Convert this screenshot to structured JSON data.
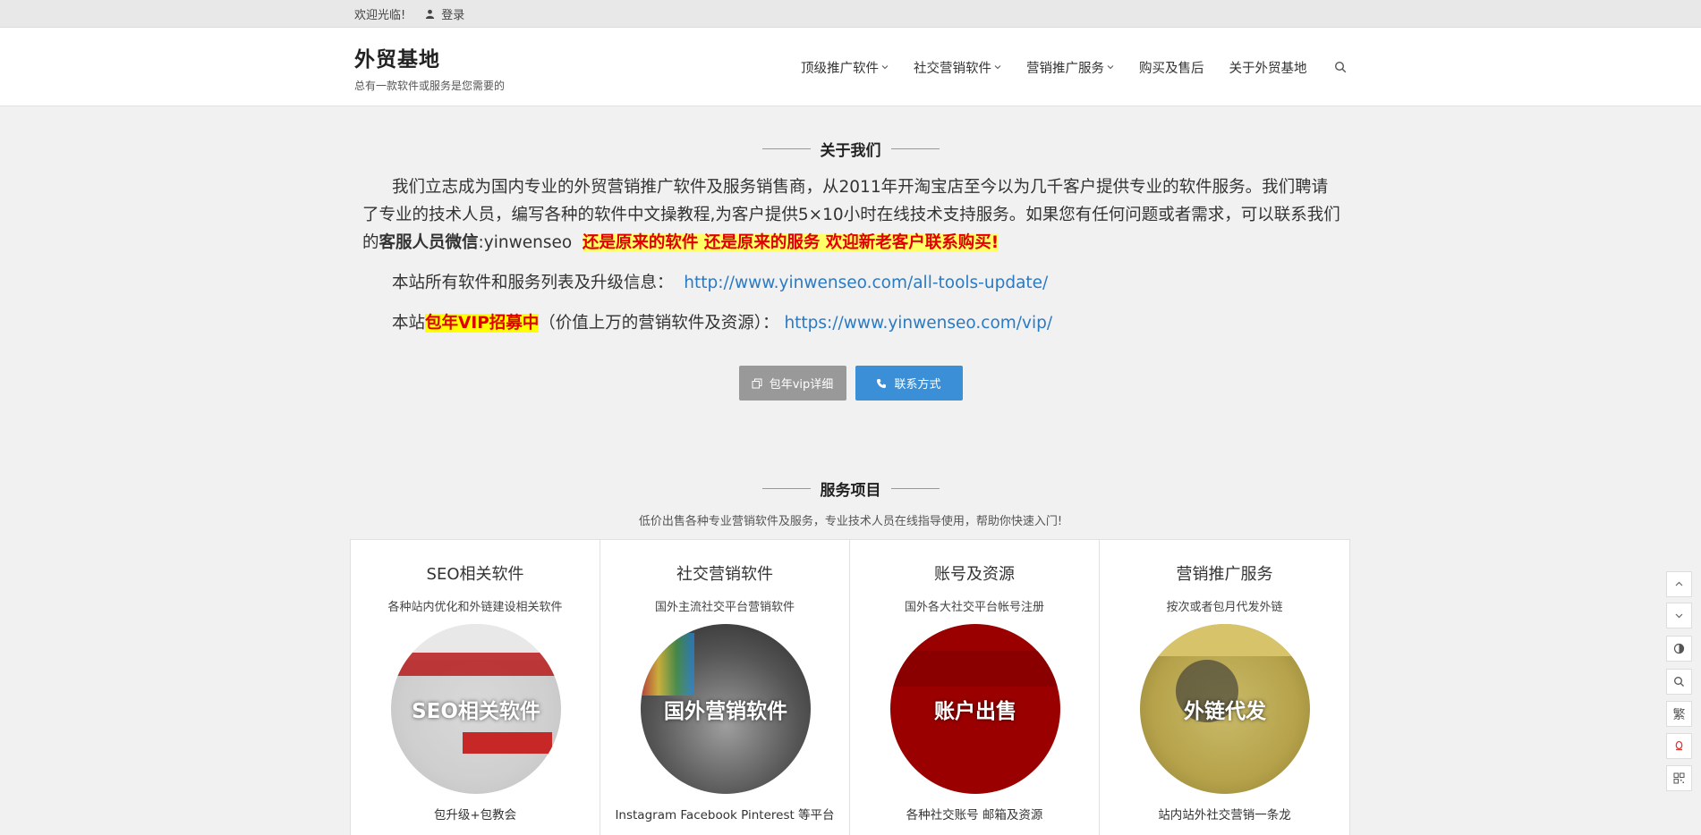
{
  "topbar": {
    "welcome": "欢迎光临!",
    "login": "登录"
  },
  "header": {
    "site_title": "外贸基地",
    "tagline": "总有一款软件或服务是您需要的",
    "nav": [
      {
        "label": "顶级推广软件",
        "has_dropdown": true
      },
      {
        "label": "社交营销软件",
        "has_dropdown": true
      },
      {
        "label": "营销推广服务",
        "has_dropdown": true
      },
      {
        "label": "购买及售后",
        "has_dropdown": false
      },
      {
        "label": "关于外贸基地",
        "has_dropdown": false
      }
    ]
  },
  "about": {
    "title": "关于我们",
    "para_part1": "我们立志成为国内专业的外贸营销推广软件及服务销售商，从2011年开淘宝店至今以为几千客户提供专业的软件服务。我们聘请了专业的技术人员，编写各种的软件中文操教程,为客户提供5×10小时在线技术支持服务。如果您有任何问题或者需求，可以联系我们的",
    "para_bold": "客服人员微信",
    "para_wechat": ":yinwenseo",
    "para_red": "还是原来的软件 还是原来的服务 欢迎新老客户联系购买!",
    "row1_label": "本站所有软件和服务列表及升级信息：",
    "row1_link": "http://www.yinwenseo.com/all-tools-update/",
    "row2_prefix": "本站",
    "row2_highlight": "包年VIP招募中",
    "row2_suffix": "（价值上万的营销软件及资源）：",
    "row2_link": "https://www.yinwenseo.com/vip/"
  },
  "buttons": {
    "vip": "包年vip详细",
    "contact": "联系方式"
  },
  "services": {
    "title": "服务项目",
    "subtitle": "低价出售各种专业营销软件及服务，专业技术人员在线指导使用，帮助你快速入门!",
    "cards": [
      {
        "title": "SEO相关软件",
        "desc": "各种站内优化和外链建设相关软件",
        "image_text": "SEO相关软件",
        "footer": "包升级+包教会"
      },
      {
        "title": "社交营销软件",
        "desc": "国外主流社交平台营销软件",
        "image_text": "国外营销软件",
        "footer": "Instagram Facebook Pinterest 等平台"
      },
      {
        "title": "账号及资源",
        "desc": "国外各大社交平台帐号注册",
        "image_text": "账户出售",
        "footer": "各种社交账号 邮箱及资源"
      },
      {
        "title": "营销推广服务",
        "desc": "按次或者包月代发外链",
        "image_text": "外链代发",
        "footer": "站内站外社交营销一条龙"
      }
    ]
  },
  "float_bar": {
    "traditional_label": "繁"
  },
  "colors": {
    "accent_blue": "#3a8fd6",
    "highlight_red": "#e00000",
    "highlight_yellow": "#ffff00"
  }
}
